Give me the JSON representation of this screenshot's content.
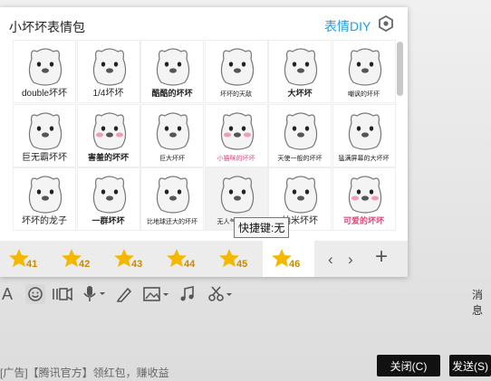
{
  "panel": {
    "title": "小坏坏表情包",
    "diy_label": "表情DIY",
    "settings_icon": "hexagon-settings-icon"
  },
  "stickers": [
    {
      "caption": "double坏坏"
    },
    {
      "caption": "1/4坏坏"
    },
    {
      "caption": "酷酷的坏坏"
    },
    {
      "caption": "坏坏的天敌"
    },
    {
      "caption": "大坏坏"
    },
    {
      "caption": "嘲讽的坏坏"
    },
    {
      "caption": "巨无霸坏坏"
    },
    {
      "caption": "害羞的坏坏"
    },
    {
      "caption": "巨大坏坏"
    },
    {
      "caption": "小猫咪的坏坏"
    },
    {
      "caption": "天使一般的坏坏"
    },
    {
      "caption": "猛满屏幕的大坏坏"
    },
    {
      "caption": "坏坏的龙子"
    },
    {
      "caption": "一群坏坏"
    },
    {
      "caption": "比地球还大的坏坏"
    },
    {
      "caption": "无人气三幅坏"
    },
    {
      "caption": "纳米坏坏"
    },
    {
      "caption": "可爱的坏坏"
    }
  ],
  "tooltip": "快捷键:无",
  "tabs": [
    {
      "label": "41"
    },
    {
      "label": "42"
    },
    {
      "label": "43"
    },
    {
      "label": "44"
    },
    {
      "label": "45"
    },
    {
      "label": "46"
    }
  ],
  "nav": {
    "prev": "‹",
    "next": "›",
    "add": "+"
  },
  "toolbar": {
    "font_icon": "A",
    "message_label": "消息"
  },
  "footer": {
    "ad_text": "[广告]【腾讯官方】领红包，赚收益",
    "close_label": "关闭(C)",
    "send_label": "发送(S)"
  },
  "colors": {
    "accent": "#1aa0e6",
    "star": "#f5b800",
    "button": "#111111"
  }
}
